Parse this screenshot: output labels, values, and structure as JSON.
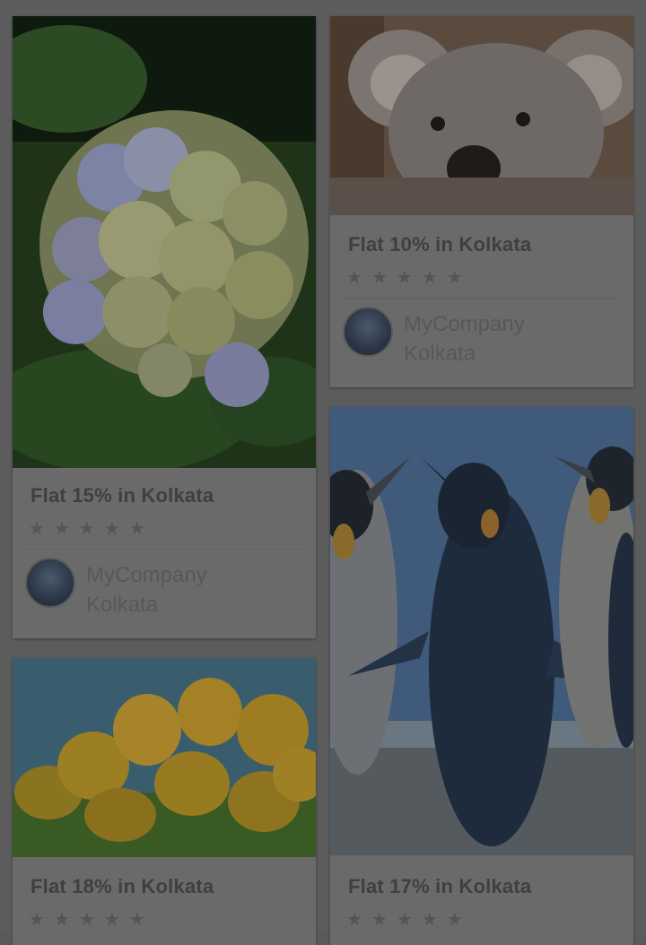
{
  "cards": [
    {
      "title": "Flat 15% in Kolkata",
      "rating": 0,
      "company": "MyCompany",
      "city": "Kolkata",
      "image": "hydrangea-flowers"
    },
    {
      "title": "Flat 10% in Kolkata",
      "rating": 0,
      "company": "MyCompany",
      "city": "Kolkata",
      "image": "koala"
    },
    {
      "title": "Flat 18% in Kolkata",
      "rating": 0,
      "image": "yellow-tulips"
    },
    {
      "title": "Flat 17% in Kolkata",
      "rating": 0,
      "image": "penguins"
    }
  ],
  "star_glyph": "★",
  "colors": {
    "overlay": "#5c5c5c",
    "card": "#6a6a6a"
  }
}
